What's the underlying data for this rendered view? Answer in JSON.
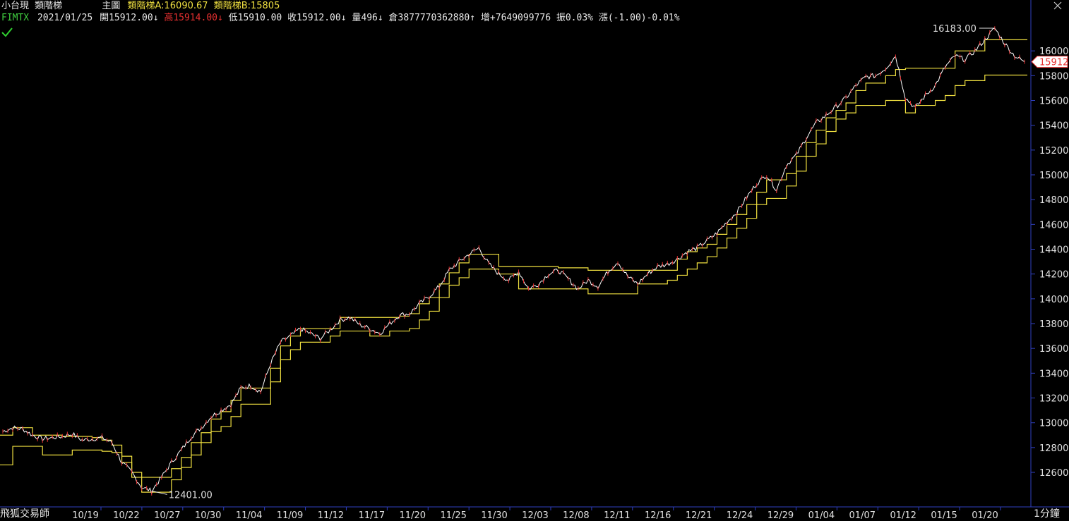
{
  "header": {
    "product": "小台現",
    "indicator_name": "類階梯",
    "main_label": "主圖",
    "ladder_a": "類階梯A:16090.67",
    "ladder_b": "類階梯B:15805",
    "symbol": "FIMTX",
    "date": "2021/01/25",
    "open": "開15912.00",
    "open_arrow": "↓",
    "high": "高15914.00",
    "high_arrow": "↓",
    "low": "低15910.00",
    "close": "收15912.00",
    "close_arrow": "↓",
    "volume": "量496",
    "volume_arrow": "↓",
    "open_interest": "倉3877770362880",
    "oi_arrow": "↑",
    "oi_change": "增+7649099776",
    "amplitude": "振0.03%",
    "change": "漲(-1.00)-0.01%"
  },
  "footer": {
    "app_name": "飛狐交易師",
    "interval": "1分鐘"
  },
  "icons": {
    "check": "checkmark-icon",
    "close": "close-icon"
  },
  "colors": {
    "background": "#000000",
    "price": "#ffffff",
    "ladder": "#f0e040",
    "axis": "#2f3fbf",
    "last_price": "#e83030"
  },
  "chart_data": {
    "type": "line",
    "x_labels": [
      "10/19",
      "10/22",
      "10/27",
      "10/30",
      "11/04",
      "11/09",
      "11/12",
      "11/17",
      "11/20",
      "11/25",
      "11/30",
      "12/03",
      "12/08",
      "12/11",
      "12/16",
      "12/21",
      "12/24",
      "12/29",
      "01/04",
      "01/07",
      "01/12",
      "01/15",
      "01/20"
    ],
    "y_ticks": [
      12600,
      12800,
      13000,
      13200,
      13400,
      13600,
      13800,
      14000,
      14200,
      14400,
      14600,
      14800,
      15000,
      15200,
      15400,
      15600,
      15800,
      16000
    ],
    "ylim": [
      12401,
      16183
    ],
    "max_label": "16183.00",
    "min_label": "12401.00",
    "last_price_label": "15912",
    "series": [
      {
        "values": [
          12930,
          12960,
          12950,
          12900,
          12870,
          12880,
          12890,
          12910,
          12860,
          12870,
          12880,
          12840,
          12680,
          12600,
          12480,
          12450,
          12560,
          12680,
          12780,
          12890,
          12960,
          13050,
          13100,
          13150,
          13280,
          13300,
          13250,
          13480,
          13650,
          13700,
          13760,
          13720,
          13680,
          13750,
          13830,
          13850,
          13790,
          13760,
          13720,
          13800,
          13870,
          13880,
          13960,
          14020,
          14100,
          14230,
          14300,
          14360,
          14410,
          14280,
          14200,
          14150,
          14220,
          14080,
          14120,
          14200,
          14230,
          14160,
          14080,
          14150,
          14100,
          14220,
          14300,
          14180,
          14120,
          14200,
          14260,
          14280,
          14320,
          14380,
          14410,
          14470,
          14530,
          14620,
          14700,
          14820,
          14930,
          15000,
          14880,
          15080,
          15160,
          15300,
          15420,
          15480,
          15550,
          15620,
          15720,
          15790,
          15800,
          15860,
          15960,
          15620,
          15540,
          15640,
          15720,
          15870,
          15960,
          15930,
          16000,
          16090,
          16183,
          16060,
          15960,
          15912
        ]
      }
    ],
    "ladder_a": {
      "values": [
        12900,
        12960,
        12960,
        12900,
        12900,
        12900,
        12890,
        12890,
        12890,
        12880,
        12860,
        12820,
        12730,
        12600,
        12560,
        12560,
        12560,
        12630,
        12720,
        12840,
        12920,
        13030,
        13090,
        13180,
        13280,
        13280,
        13280,
        13440,
        13620,
        13700,
        13760,
        13760,
        13760,
        13760,
        13850,
        13850,
        13850,
        13850,
        13850,
        13850,
        13860,
        13880,
        13960,
        14010,
        14120,
        14210,
        14290,
        14360,
        14360,
        14360,
        14260,
        14260,
        14260,
        14260,
        14260,
        14260,
        14250,
        14250,
        14250,
        14230,
        14230,
        14230,
        14230,
        14230,
        14230,
        14230,
        14230,
        14230,
        14320,
        14380,
        14410,
        14440,
        14520,
        14600,
        14680,
        14760,
        14860,
        14960,
        14960,
        15010,
        15150,
        15260,
        15360,
        15460,
        15520,
        15580,
        15680,
        15740,
        15740,
        15800,
        15850,
        15860,
        15860,
        15860,
        15860,
        15860,
        16000,
        16000,
        16000,
        16090,
        16090,
        16090,
        16090,
        16090
      ]
    },
    "ladder_b": {
      "values": [
        12660,
        12810,
        12810,
        12810,
        12740,
        12740,
        12740,
        12780,
        12780,
        12780,
        12770,
        12760,
        12680,
        12560,
        12440,
        12440,
        12440,
        12540,
        12640,
        12740,
        12840,
        12930,
        12970,
        13050,
        13150,
        13150,
        13150,
        13330,
        13510,
        13590,
        13650,
        13650,
        13650,
        13700,
        13740,
        13740,
        13740,
        13700,
        13700,
        13740,
        13740,
        13760,
        13830,
        13900,
        14010,
        14110,
        14170,
        14240,
        14240,
        14240,
        14200,
        14200,
        14080,
        14080,
        14080,
        14080,
        14080,
        14080,
        14080,
        14040,
        14040,
        14040,
        14040,
        14040,
        14120,
        14120,
        14120,
        14150,
        14190,
        14240,
        14290,
        14340,
        14410,
        14490,
        14570,
        14650,
        14760,
        14810,
        14810,
        14910,
        15030,
        15150,
        15250,
        15350,
        15450,
        15500,
        15560,
        15560,
        15560,
        15600,
        15600,
        15500,
        15560,
        15560,
        15600,
        15640,
        15720,
        15760,
        15760,
        15805,
        15805,
        15805,
        15805,
        15805
      ]
    }
  }
}
